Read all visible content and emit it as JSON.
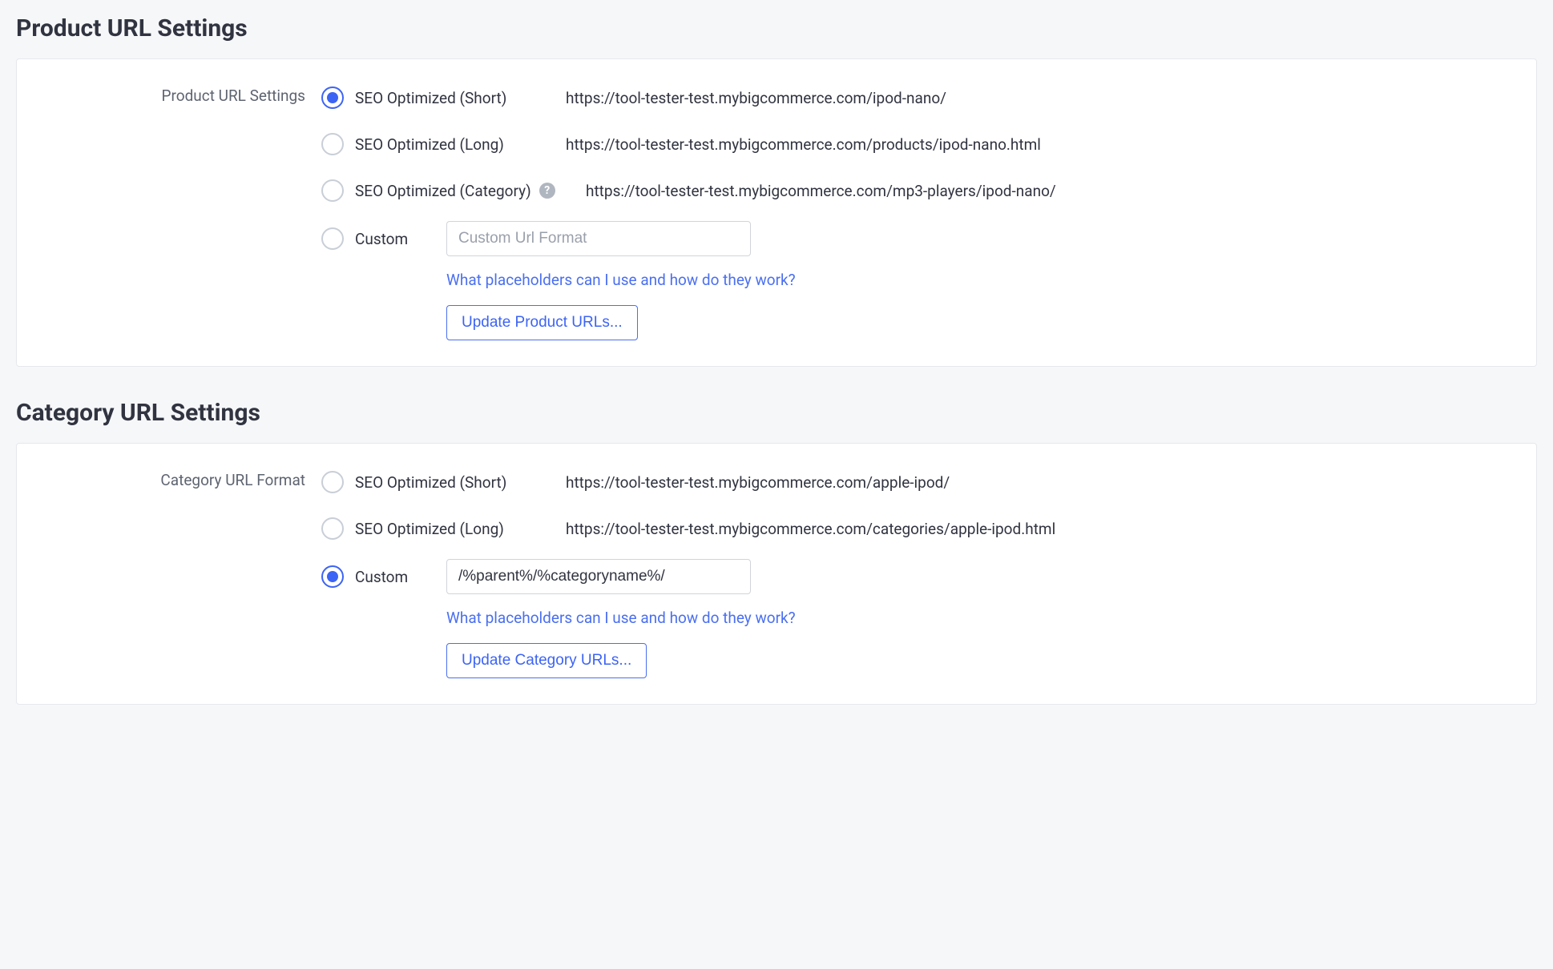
{
  "product": {
    "heading": "Product URL Settings",
    "label": "Product URL Settings",
    "options": {
      "short": {
        "label": "SEO Optimized (Short)",
        "url": "https://tool-tester-test.mybigcommerce.com/ipod-nano/"
      },
      "long": {
        "label": "SEO Optimized (Long)",
        "url": "https://tool-tester-test.mybigcommerce.com/products/ipod-nano.html"
      },
      "category": {
        "label": "SEO Optimized (Category)",
        "url": "https://tool-tester-test.mybigcommerce.com/mp3-players/ipod-nano/"
      },
      "custom": {
        "label": "Custom",
        "placeholder": "Custom Url Format",
        "value": ""
      }
    },
    "help_link": "What placeholders can I use and how do they work?",
    "update_button": "Update Product URLs..."
  },
  "category": {
    "heading": "Category URL Settings",
    "label": "Category URL Format",
    "options": {
      "short": {
        "label": "SEO Optimized (Short)",
        "url": "https://tool-tester-test.mybigcommerce.com/apple-ipod/"
      },
      "long": {
        "label": "SEO Optimized (Long)",
        "url": "https://tool-tester-test.mybigcommerce.com/categories/apple-ipod.html"
      },
      "custom": {
        "label": "Custom",
        "value": "/%parent%/%categoryname%/"
      }
    },
    "help_link": "What placeholders can I use and how do they work?",
    "update_button": "Update Category URLs..."
  },
  "icons": {
    "help": "?"
  }
}
